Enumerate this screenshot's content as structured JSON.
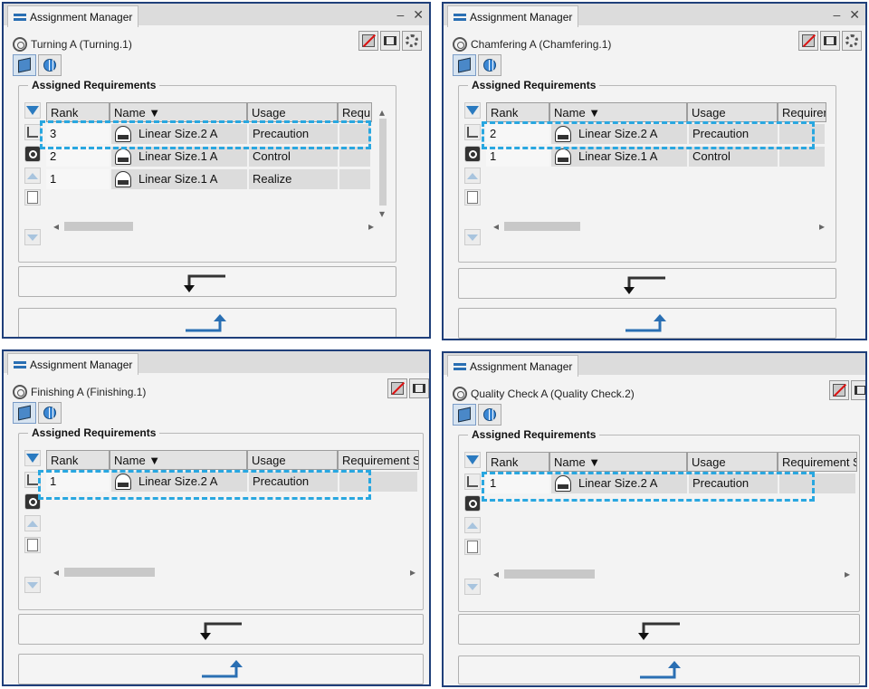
{
  "tab_label": "Assignment Manager",
  "group_title": "Assigned Requirements",
  "headers": {
    "rank": "Rank",
    "name": "Name",
    "usage": "Usage"
  },
  "panels": [
    {
      "operation": "Turning A (Turning.1)",
      "req_header": "Requ",
      "rows": [
        {
          "rank": "3",
          "name": "Linear Size.2 A",
          "usage": "Precaution"
        },
        {
          "rank": "2",
          "name": "Linear Size.1 A",
          "usage": "Control"
        },
        {
          "rank": "1",
          "name": "Linear Size.1 A",
          "usage": "Realize"
        }
      ]
    },
    {
      "operation": "Chamfering A (Chamfering.1)",
      "req_header": "Requiren",
      "rows": [
        {
          "rank": "2",
          "name": "Linear Size.2 A",
          "usage": "Precaution"
        },
        {
          "rank": "1",
          "name": "Linear Size.1 A",
          "usage": "Control"
        }
      ]
    },
    {
      "operation": "Finishing A (Finishing.1)",
      "req_header": "Requirement S",
      "rows": [
        {
          "rank": "1",
          "name": "Linear Size.2 A",
          "usage": "Precaution"
        }
      ]
    },
    {
      "operation": "Quality Check A (Quality Check.2)",
      "req_header": "Requirement S",
      "rows": [
        {
          "rank": "1",
          "name": "Linear Size.2 A",
          "usage": "Precaution"
        }
      ]
    }
  ],
  "icons": [
    "swap-icon",
    "minimize-icon",
    "close-icon",
    "operation-gear-icon",
    "no-entry-icon",
    "columns-icon",
    "settings-icon",
    "cube-icon",
    "globe-icon",
    "filter-icon",
    "tree-icon",
    "search-icon",
    "up-icon",
    "document-icon",
    "down-icon",
    "pass-arrow-icon",
    "get-arrow-icon"
  ],
  "colors": {
    "highlight": "#29a7e0",
    "frame": "#1f3f7a",
    "accent": "#2a6fb3"
  }
}
